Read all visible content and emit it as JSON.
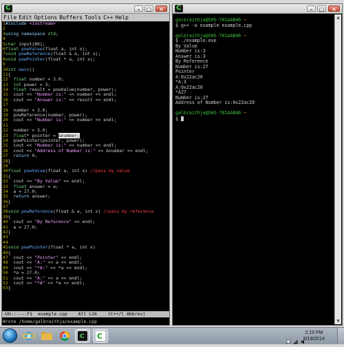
{
  "emacs": {
    "menu": [
      "File",
      "Edit",
      "Options",
      "Buffers",
      "Tools",
      "C++",
      "Help"
    ],
    "code_lines": [
      [
        [
          "ln",
          "1"
        ],
        [
          "kw",
          "#include"
        ],
        [
          "txt",
          " "
        ],
        [
          "str",
          "<iostream>"
        ]
      ],
      [
        [
          "ln",
          "2"
        ]
      ],
      [
        [
          "ln",
          "3"
        ],
        [
          "kw",
          "using namespace"
        ],
        [
          "txt",
          " "
        ],
        [
          "ty",
          "std"
        ],
        [
          "txt",
          ";"
        ]
      ],
      [
        [
          "ln",
          "4"
        ]
      ],
      [
        [
          "ln",
          "5"
        ],
        [
          "ty",
          "char"
        ],
        [
          "txt",
          " input[80];"
        ]
      ],
      [
        [
          "ln",
          "6"
        ],
        [
          "ty",
          "float"
        ],
        [
          "txt",
          " "
        ],
        [
          "fn",
          "powValue"
        ],
        [
          "txt",
          "(float a, int x);"
        ]
      ],
      [
        [
          "ln",
          "7"
        ],
        [
          "ty",
          "void"
        ],
        [
          "txt",
          " "
        ],
        [
          "fn",
          "powReference"
        ],
        [
          "txt",
          "(float & a, int x);"
        ]
      ],
      [
        [
          "ln",
          "8"
        ],
        [
          "ty",
          "void"
        ],
        [
          "txt",
          " "
        ],
        [
          "fn",
          "powPointer"
        ],
        [
          "txt",
          "(float * a, int x);"
        ]
      ],
      [
        [
          "ln",
          "9"
        ]
      ],
      [
        [
          "ln",
          "10"
        ],
        [
          "ty",
          "int"
        ],
        [
          "txt",
          " "
        ],
        [
          "fn",
          "main"
        ],
        [
          "txt",
          "()"
        ]
      ],
      [
        [
          "ln",
          "11"
        ],
        [
          "txt",
          "{"
        ]
      ],
      [
        [
          "ln",
          "12"
        ],
        [
          "txt",
          "  "
        ],
        [
          "ty",
          "float"
        ],
        [
          "txt",
          " number = 3.0;"
        ]
      ],
      [
        [
          "ln",
          "13"
        ],
        [
          "txt",
          "  "
        ],
        [
          "ty",
          "int"
        ],
        [
          "txt",
          " power = 3;"
        ]
      ],
      [
        [
          "ln",
          "14"
        ],
        [
          "txt",
          "  "
        ],
        [
          "ty",
          "float"
        ],
        [
          "txt",
          " result = powValue(number, power);"
        ]
      ],
      [
        [
          "ln",
          "15"
        ],
        [
          "txt",
          "  cout << "
        ],
        [
          "str",
          "\"Number is:\""
        ],
        [
          "txt",
          " << number << endl;"
        ]
      ],
      [
        [
          "ln",
          "16"
        ],
        [
          "txt",
          "  cout << "
        ],
        [
          "str",
          "\"Answer is:\""
        ],
        [
          "txt",
          " << result << endl;"
        ]
      ],
      [
        [
          "ln",
          "17"
        ]
      ],
      [
        [
          "ln",
          "18"
        ],
        [
          "txt",
          "  number = 3.0;"
        ]
      ],
      [
        [
          "ln",
          "19"
        ],
        [
          "txt",
          "  powReference(number, power);"
        ]
      ],
      [
        [
          "ln",
          "20"
        ],
        [
          "txt",
          "  cout << "
        ],
        [
          "str",
          "\"Number is:\""
        ],
        [
          "txt",
          " << number << endl;"
        ]
      ],
      [
        [
          "ln",
          "21"
        ]
      ],
      [
        [
          "ln",
          "22"
        ],
        [
          "txt",
          "  number = 3.0;"
        ]
      ],
      [
        [
          "ln",
          "23"
        ],
        [
          "txt",
          "  "
        ],
        [
          "ty",
          "float"
        ],
        [
          "txt",
          "* pointer = "
        ],
        [
          "cur",
          "&number;"
        ]
      ],
      [
        [
          "ln",
          "24"
        ],
        [
          "txt",
          "  powPointer(pointer, power);"
        ]
      ],
      [
        [
          "ln",
          "25"
        ],
        [
          "txt",
          "  cout << "
        ],
        [
          "str",
          "\"Number is:\""
        ],
        [
          "txt",
          " << number << endl;"
        ]
      ],
      [
        [
          "ln",
          "26"
        ],
        [
          "txt",
          "  cout << "
        ],
        [
          "str",
          "\"Address of Number is:\""
        ],
        [
          "txt",
          " << &number << endl;"
        ]
      ],
      [
        [
          "ln",
          "27"
        ],
        [
          "txt",
          "  "
        ],
        [
          "kw",
          "return"
        ],
        [
          "txt",
          " 0;"
        ]
      ],
      [
        [
          "ln",
          "28"
        ],
        [
          "txt",
          "}"
        ]
      ],
      [
        [
          "ln",
          "29"
        ]
      ],
      [
        [
          "ln",
          "30"
        ],
        [
          "ty",
          "float"
        ],
        [
          "txt",
          " "
        ],
        [
          "fn",
          "powValue"
        ],
        [
          "txt",
          "(float a, int x) "
        ],
        [
          "cm",
          "//pass by value"
        ]
      ],
      [
        [
          "ln",
          "31"
        ],
        [
          "txt",
          "{"
        ]
      ],
      [
        [
          "ln",
          "32"
        ],
        [
          "txt",
          "  cout << "
        ],
        [
          "str",
          "\"By Value\""
        ],
        [
          "txt",
          " << endl;"
        ]
      ],
      [
        [
          "ln",
          "33"
        ],
        [
          "txt",
          "  "
        ],
        [
          "ty",
          "float"
        ],
        [
          "txt",
          " answer = a;"
        ]
      ],
      [
        [
          "ln",
          "34"
        ],
        [
          "txt",
          "  a = 27.0;"
        ]
      ],
      [
        [
          "ln",
          "35"
        ],
        [
          "txt",
          "  "
        ],
        [
          "kw",
          "return"
        ],
        [
          "txt",
          " answer;"
        ]
      ],
      [
        [
          "ln",
          "36"
        ],
        [
          "txt",
          "}"
        ]
      ],
      [
        [
          "ln",
          "37"
        ]
      ],
      [
        [
          "ln",
          "38"
        ],
        [
          "ty",
          "void"
        ],
        [
          "txt",
          " "
        ],
        [
          "fn",
          "powReference"
        ],
        [
          "txt",
          "(float & a, int x) "
        ],
        [
          "cm",
          "//pass by reference"
        ]
      ],
      [
        [
          "ln",
          "39"
        ],
        [
          "txt",
          "{"
        ]
      ],
      [
        [
          "ln",
          "40"
        ],
        [
          "txt",
          "  cout << "
        ],
        [
          "str",
          "\"By Reference\""
        ],
        [
          "txt",
          " << endl;"
        ]
      ],
      [
        [
          "ln",
          "41"
        ],
        [
          "txt",
          "  a = 27.0;"
        ]
      ],
      [
        [
          "ln",
          "42"
        ],
        [
          "txt",
          "}"
        ]
      ],
      [
        [
          "ln",
          "43"
        ]
      ],
      [
        [
          "ln",
          "44"
        ]
      ],
      [
        [
          "ln",
          "45"
        ],
        [
          "ty",
          "void"
        ],
        [
          "txt",
          " "
        ],
        [
          "fn",
          "powPointer"
        ],
        [
          "txt",
          "(float * a, int x)"
        ]
      ],
      [
        [
          "ln",
          "46"
        ],
        [
          "txt",
          "{"
        ]
      ],
      [
        [
          "ln",
          "47"
        ],
        [
          "txt",
          "  cout << "
        ],
        [
          "str",
          "\"Pointer\""
        ],
        [
          "txt",
          " << endl;"
        ]
      ],
      [
        [
          "ln",
          "48"
        ],
        [
          "txt",
          "  cout << "
        ],
        [
          "str",
          "\"A:\""
        ],
        [
          "txt",
          " << a << endl;"
        ]
      ],
      [
        [
          "ln",
          "49"
        ],
        [
          "txt",
          "  cout << "
        ],
        [
          "str",
          "\"*A:\""
        ],
        [
          "txt",
          " << *a << endl;"
        ]
      ],
      [
        [
          "ln",
          "50"
        ],
        [
          "txt",
          "  *a = 27.0;"
        ]
      ],
      [
        [
          "ln",
          "51"
        ],
        [
          "txt",
          "  cout << "
        ],
        [
          "str",
          "\"A:\""
        ],
        [
          "txt",
          " << a << endl;"
        ]
      ],
      [
        [
          "ln",
          "52"
        ],
        [
          "txt",
          "  cout << "
        ],
        [
          "str",
          "\"*A\""
        ],
        [
          "txt",
          " << *a << endl;"
        ]
      ],
      [
        [
          "ln",
          "53"
        ],
        [
          "txt",
          "}"
        ]
      ]
    ],
    "modeline": "-UU-:----F1  example.cpp    All L26    (C++/l Abbrev)",
    "minibuffer": "Wrote /home/galbraithja/example.cpp"
  },
  "terminal": {
    "lines": [
      [
        [
          "user",
          "galbraithja@SHS-701AAB46"
        ],
        [
          "dir",
          " ~"
        ]
      ],
      [
        [
          "txt",
          "$ g++ -o example example.cpp"
        ]
      ],
      [
        [
          "txt",
          ""
        ]
      ],
      [
        [
          "user",
          "galbraithja@SHS-701AAB46"
        ],
        [
          "dir",
          " ~"
        ]
      ],
      [
        [
          "txt",
          "$ ./example.exe"
        ]
      ],
      [
        [
          "txt",
          "By Value"
        ]
      ],
      [
        [
          "txt",
          "Number is:3"
        ]
      ],
      [
        [
          "txt",
          "Answer is:3"
        ]
      ],
      [
        [
          "txt",
          "By Reference"
        ]
      ],
      [
        [
          "txt",
          "Number is:27"
        ]
      ],
      [
        [
          "txt",
          "Pointer"
        ]
      ],
      [
        [
          "txt",
          "A:0x22ac20"
        ]
      ],
      [
        [
          "txt",
          "*A:3"
        ]
      ],
      [
        [
          "txt",
          "A:0x22ac20"
        ]
      ],
      [
        [
          "txt",
          "*A27"
        ]
      ],
      [
        [
          "txt",
          "Number is:27"
        ]
      ],
      [
        [
          "txt",
          "Address of Number is:0x22ac20"
        ]
      ],
      [
        [
          "txt",
          ""
        ]
      ],
      [
        [
          "user",
          "galbraithja@SHS-701AAB46"
        ],
        [
          "dir",
          " ~"
        ]
      ],
      [
        [
          "txt",
          "$ "
        ],
        [
          "cursor",
          ""
        ]
      ]
    ]
  },
  "taskbar": {
    "time": "2:19 PM",
    "date": "9/19/2014",
    "apps": [
      "ie-icon",
      "folder-icon",
      "chrome-icon",
      "terminal-icon",
      "cygwin-icon"
    ]
  },
  "colors": {
    "line_number": "#c8b400",
    "keyword": "#8fd0ff",
    "type": "#7cd67c",
    "string": "#f2a0ff",
    "comment": "#ff4040",
    "prompt_user": "#3fc23f",
    "prompt_dir": "#c8a800"
  }
}
